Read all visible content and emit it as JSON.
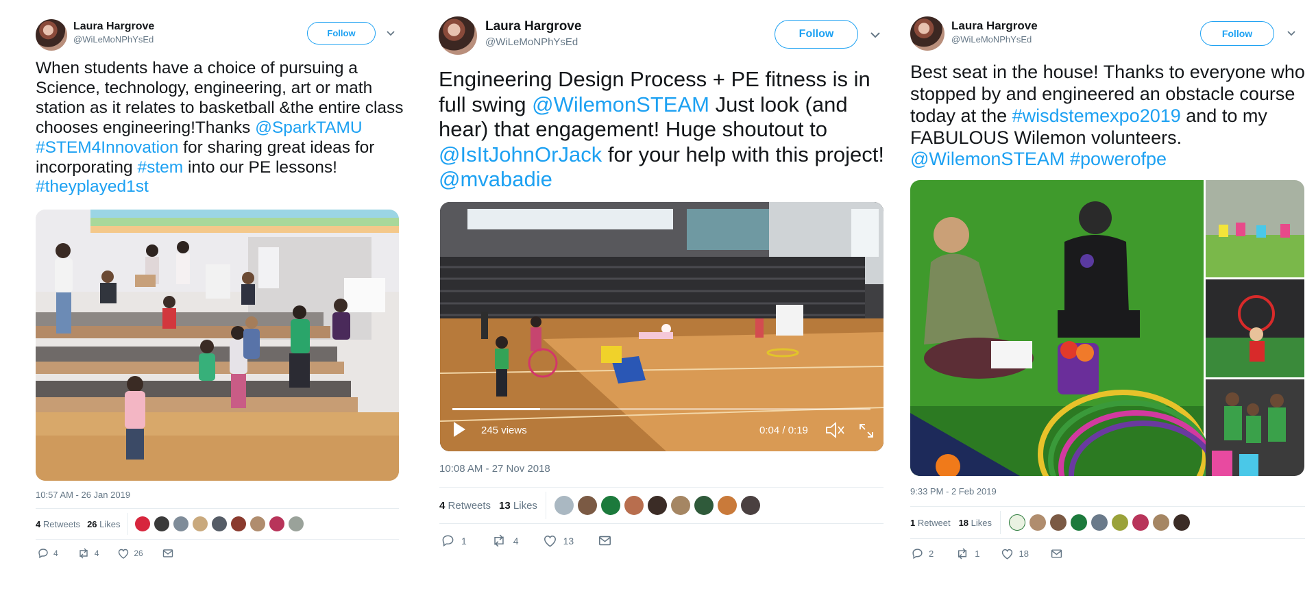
{
  "tweets": [
    {
      "name": "Laura Hargrove",
      "handle": "@WiLeMoNPhYsEd",
      "follow": "Follow",
      "text": [
        {
          "t": "When students have a choice of pursuing a Science, technology, engineering, art or math station as it relates to basketball &the entire class chooses engineering!Thanks "
        },
        {
          "t": "@SparkTAMU",
          "link": true
        },
        {
          "t": " "
        },
        {
          "t": "#STEM4Innovation",
          "link": true
        },
        {
          "t": " for sharing great ideas for incorporating "
        },
        {
          "t": "#stem",
          "link": true
        },
        {
          "t": " into our PE lessons! "
        },
        {
          "t": "#theyplayed1st",
          "link": true
        }
      ],
      "timestamp": "10:57 AM - 26 Jan 2019",
      "retweets": "4",
      "retweets_label": "Retweets",
      "likes": "26",
      "likes_label": "Likes",
      "actions": {
        "reply": "4",
        "retweet": "4",
        "like": "26"
      }
    },
    {
      "name": "Laura Hargrove",
      "handle": "@WiLeMoNPhYsEd",
      "follow": "Follow",
      "text": [
        {
          "t": "Engineering Design Process + PE fitness is in full swing "
        },
        {
          "t": "@WilemonSTEAM",
          "link": true
        },
        {
          "t": " Just look (and hear) that engagement! Huge shoutout to "
        },
        {
          "t": "@IsItJohnOrJack",
          "link": true
        },
        {
          "t": " for your help with this project! "
        },
        {
          "t": "@mvabadie",
          "link": true
        }
      ],
      "video": {
        "views": "245 views",
        "time": "0:04 / 0:19",
        "progress": 0.21
      },
      "timestamp": "10:08 AM - 27 Nov 2018",
      "retweets": "4",
      "retweets_label": "Retweets",
      "likes": "13",
      "likes_label": "Likes",
      "actions": {
        "reply": "1",
        "retweet": "4",
        "like": "13"
      }
    },
    {
      "name": "Laura Hargrove",
      "handle": "@WiLeMoNPhYsEd",
      "follow": "Follow",
      "text": [
        {
          "t": "Best seat in the house! Thanks to everyone who stopped by and engineered an obstacle course today at the "
        },
        {
          "t": "#wisdstemexpo2019",
          "link": true
        },
        {
          "t": " and to my FABULOUS Wilemon volunteers. "
        },
        {
          "t": "@WilemonSTEAM",
          "link": true
        },
        {
          "t": " "
        },
        {
          "t": "#powerofpe",
          "link": true
        }
      ],
      "timestamp": "9:33 PM - 2 Feb 2019",
      "retweets": "1",
      "retweets_label": "Retweet",
      "likes": "18",
      "likes_label": "Likes",
      "actions": {
        "reply": "2",
        "retweet": "1",
        "like": "18"
      }
    }
  ],
  "colors": {
    "link": "#1da1f2",
    "muted": "#657786",
    "text": "#14171a",
    "border": "#e6ecf0"
  }
}
